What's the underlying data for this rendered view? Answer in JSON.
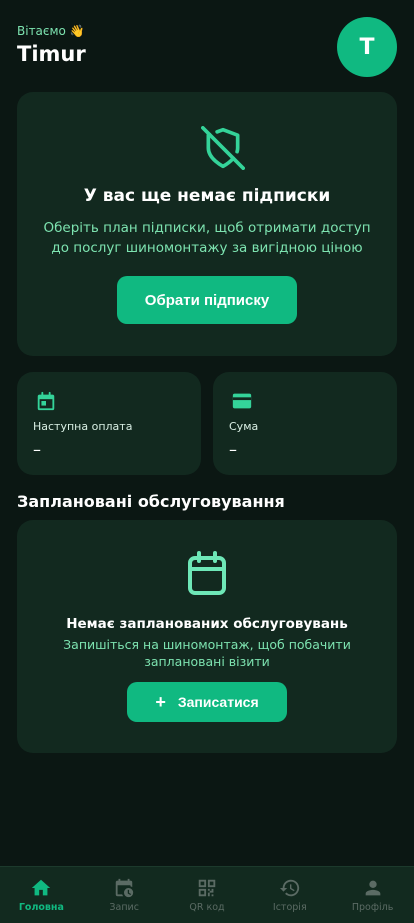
{
  "header": {
    "greeting": "Вітаємо 👋",
    "user_name": "Timur",
    "avatar_initial": "T"
  },
  "subscription_card": {
    "icon": "shield-off-icon",
    "title": "У вас ще немає підписки",
    "description": "Оберіть план підписки, щоб отримати доступ до послуг шиномонтажу за вигідною ціною",
    "button_label": "Обрати підписку"
  },
  "info_cards": [
    {
      "icon": "calendar-icon",
      "label": "Наступна оплата",
      "value": "–"
    },
    {
      "icon": "credit-card-icon",
      "label": "Сума",
      "value": "–"
    }
  ],
  "scheduled": {
    "section_title": "Заплановані обслуговування",
    "icon": "calendar-icon",
    "empty_title": "Немає запланованих обслуговувань",
    "empty_description": "Запишіться на шиномонтаж, щоб побачити заплановані візити",
    "button_icon": "+",
    "button_label": "Записатися"
  },
  "bottom_nav": {
    "items": [
      {
        "icon": "home-icon",
        "label": "Головна",
        "active": true
      },
      {
        "icon": "history-clock-icon",
        "label": "Запис",
        "active": false
      },
      {
        "icon": "qr-code-icon",
        "label": "QR код",
        "active": false
      },
      {
        "icon": "history-icon",
        "label": "Історія",
        "active": false
      },
      {
        "icon": "person-icon",
        "label": "Профіль",
        "active": false
      }
    ]
  },
  "colors": {
    "background": "#0b1713",
    "card": "#12291f",
    "accent": "#10b981",
    "accent_text": "#7de3b0",
    "nav_inactive": "#5b6b64"
  }
}
